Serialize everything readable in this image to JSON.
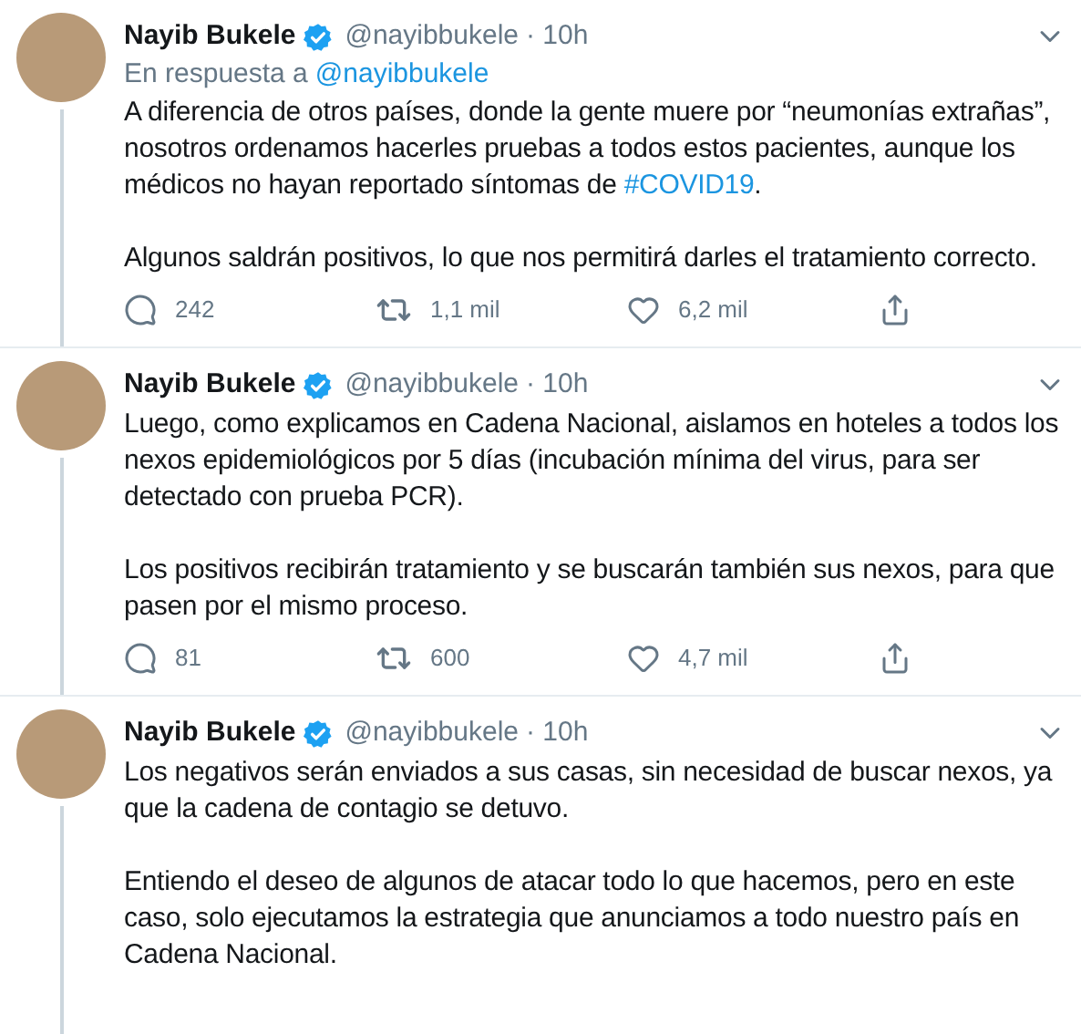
{
  "tweets": [
    {
      "name": "Nayib Bukele",
      "handle": "@nayibbukele",
      "time": "· 10h",
      "reply_to": {
        "prefix": "En respuesta a",
        "handle": "@nayibbukele"
      },
      "paragraphs": [
        [
          {
            "kind": "text",
            "text": "A diferencia de otros países, donde la gente muere por “neumonías extrañas”, nosotros ordenamos hacerles pruebas a todos estos pacientes, aunque los médicos no hayan reportado síntomas de "
          },
          {
            "kind": "hashtag",
            "text": "#COVID19"
          },
          {
            "kind": "text",
            "text": "."
          }
        ],
        [
          {
            "kind": "text",
            "text": "Algunos saldrán positivos, lo que nos permitirá darles el tratamiento correcto."
          }
        ]
      ],
      "actions": {
        "replies": "242",
        "retweets": "1,1 mil",
        "likes": "6,2 mil"
      }
    },
    {
      "name": "Nayib Bukele",
      "handle": "@nayibbukele",
      "time": "· 10h",
      "paragraphs": [
        [
          {
            "kind": "text",
            "text": "Luego, como explicamos en Cadena Nacional, aislamos en hoteles a todos los nexos epidemiológicos por 5 días (incubación mínima del virus, para ser detectado con prueba PCR)."
          }
        ],
        [
          {
            "kind": "text",
            "text": "Los positivos recibirán tratamiento y se buscarán también sus nexos, para que pasen por el mismo proceso."
          }
        ]
      ],
      "actions": {
        "replies": "81",
        "retweets": "600",
        "likes": "4,7 mil"
      }
    },
    {
      "name": "Nayib Bukele",
      "handle": "@nayibbukele",
      "time": "· 10h",
      "paragraphs": [
        [
          {
            "kind": "text",
            "text": "Los negativos serán enviados a sus casas, sin necesidad de buscar nexos, ya que la cadena de contagio se detuvo."
          }
        ],
        [
          {
            "kind": "text",
            "text": "Entiendo el deseo de algunos de atacar todo lo que hacemos, pero en este caso, solo ejecutamos la estrategia que anunciamos a todo nuestro país en Cadena Nacional."
          }
        ]
      ]
    }
  ]
}
